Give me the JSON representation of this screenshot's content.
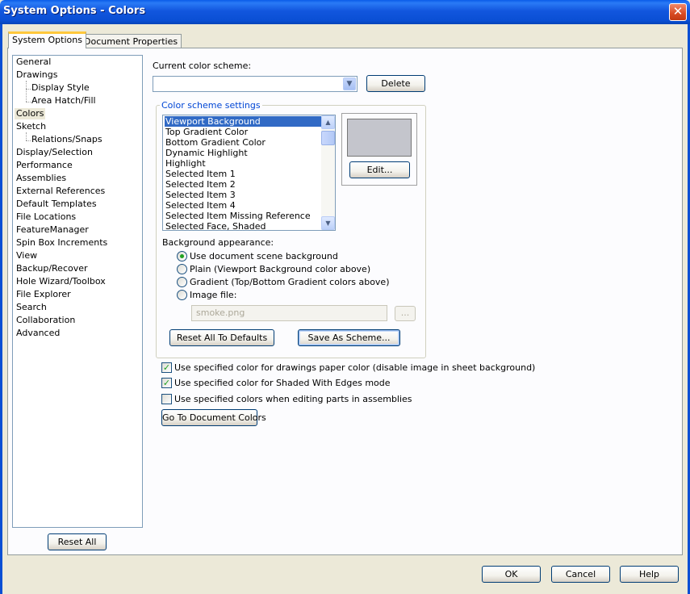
{
  "window": {
    "title": "System Options - Colors",
    "close_glyph": "✕"
  },
  "tabs": [
    {
      "label": "System Options"
    },
    {
      "label": "Document Properties"
    }
  ],
  "tree": {
    "items": [
      {
        "label": "General"
      },
      {
        "label": "Drawings"
      },
      {
        "label": "Display Style"
      },
      {
        "label": "Area Hatch/Fill"
      },
      {
        "label": "Colors"
      },
      {
        "label": "Sketch"
      },
      {
        "label": "Relations/Snaps"
      },
      {
        "label": "Display/Selection"
      },
      {
        "label": "Performance"
      },
      {
        "label": "Assemblies"
      },
      {
        "label": "External References"
      },
      {
        "label": "Default Templates"
      },
      {
        "label": "File Locations"
      },
      {
        "label": "FeatureManager"
      },
      {
        "label": "Spin Box Increments"
      },
      {
        "label": "View"
      },
      {
        "label": "Backup/Recover"
      },
      {
        "label": "Hole Wizard/Toolbox"
      },
      {
        "label": "File Explorer"
      },
      {
        "label": "Search"
      },
      {
        "label": "Collaboration"
      },
      {
        "label": "Advanced"
      }
    ],
    "selected": "Colors",
    "reset_all_label": "Reset All"
  },
  "scheme": {
    "label": "Current color scheme:",
    "value": "",
    "delete_label": "Delete"
  },
  "settings": {
    "legend": "Color scheme settings",
    "list_items": [
      {
        "label": "Viewport Background"
      },
      {
        "label": "Top Gradient Color"
      },
      {
        "label": "Bottom Gradient Color"
      },
      {
        "label": "Dynamic Highlight"
      },
      {
        "label": "Highlight"
      },
      {
        "label": "Selected Item 1"
      },
      {
        "label": "Selected Item 2"
      },
      {
        "label": "Selected Item 3"
      },
      {
        "label": "Selected Item 4"
      },
      {
        "label": "Selected Item Missing Reference"
      },
      {
        "label": "Selected Face, Shaded"
      }
    ],
    "selected_item": "Viewport Background",
    "swatch_color": "#c4c5cc",
    "edit_label": "Edit...",
    "bg_label": "Background appearance:",
    "radios": [
      {
        "label": "Use document scene background",
        "checked": true
      },
      {
        "label": "Plain (Viewport Background color above)",
        "checked": false
      },
      {
        "label": "Gradient (Top/Bottom Gradient colors above)",
        "checked": false
      },
      {
        "label": "Image file:",
        "checked": false
      }
    ],
    "image_file": "smoke.png",
    "browse_label": "...",
    "reset_defaults_label": "Reset All To Defaults",
    "save_scheme_label": "Save As Scheme..."
  },
  "checks": [
    {
      "label": "Use specified color for drawings paper color (disable image in sheet background)",
      "checked": true
    },
    {
      "label": "Use specified color for Shaded With Edges mode",
      "checked": true
    },
    {
      "label": "Use specified colors when editing parts in assemblies",
      "checked": false
    }
  ],
  "goto_doc_colors_label": "Go To Document Colors",
  "footer": {
    "ok": "OK",
    "cancel": "Cancel",
    "help": "Help"
  },
  "colors": {
    "titlebar": "#0a4fd4",
    "selection": "#316ac5",
    "check_green": "#21a121"
  },
  "icons": {
    "close": "close-icon",
    "combo_arrow": "chevron-down-icon",
    "scroll_up": "chevron-up-icon",
    "scroll_down": "chevron-down-icon"
  }
}
